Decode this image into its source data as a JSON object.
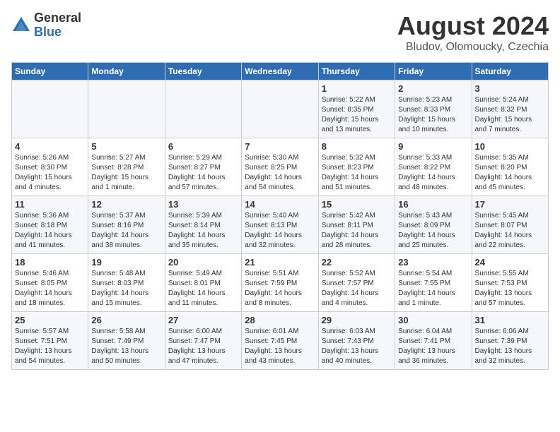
{
  "logo": {
    "general": "General",
    "blue": "Blue"
  },
  "title": {
    "month_year": "August 2024",
    "location": "Bludov, Olomoucky, Czechia"
  },
  "days_of_week": [
    "Sunday",
    "Monday",
    "Tuesday",
    "Wednesday",
    "Thursday",
    "Friday",
    "Saturday"
  ],
  "weeks": [
    [
      {
        "day": "",
        "info": ""
      },
      {
        "day": "",
        "info": ""
      },
      {
        "day": "",
        "info": ""
      },
      {
        "day": "",
        "info": ""
      },
      {
        "day": "1",
        "info": "Sunrise: 5:22 AM\nSunset: 8:35 PM\nDaylight: 15 hours\nand 13 minutes."
      },
      {
        "day": "2",
        "info": "Sunrise: 5:23 AM\nSunset: 8:33 PM\nDaylight: 15 hours\nand 10 minutes."
      },
      {
        "day": "3",
        "info": "Sunrise: 5:24 AM\nSunset: 8:32 PM\nDaylight: 15 hours\nand 7 minutes."
      }
    ],
    [
      {
        "day": "4",
        "info": "Sunrise: 5:26 AM\nSunset: 8:30 PM\nDaylight: 15 hours\nand 4 minutes."
      },
      {
        "day": "5",
        "info": "Sunrise: 5:27 AM\nSunset: 8:28 PM\nDaylight: 15 hours\nand 1 minute."
      },
      {
        "day": "6",
        "info": "Sunrise: 5:29 AM\nSunset: 8:27 PM\nDaylight: 14 hours\nand 57 minutes."
      },
      {
        "day": "7",
        "info": "Sunrise: 5:30 AM\nSunset: 8:25 PM\nDaylight: 14 hours\nand 54 minutes."
      },
      {
        "day": "8",
        "info": "Sunrise: 5:32 AM\nSunset: 8:23 PM\nDaylight: 14 hours\nand 51 minutes."
      },
      {
        "day": "9",
        "info": "Sunrise: 5:33 AM\nSunset: 8:22 PM\nDaylight: 14 hours\nand 48 minutes."
      },
      {
        "day": "10",
        "info": "Sunrise: 5:35 AM\nSunset: 8:20 PM\nDaylight: 14 hours\nand 45 minutes."
      }
    ],
    [
      {
        "day": "11",
        "info": "Sunrise: 5:36 AM\nSunset: 8:18 PM\nDaylight: 14 hours\nand 41 minutes."
      },
      {
        "day": "12",
        "info": "Sunrise: 5:37 AM\nSunset: 8:16 PM\nDaylight: 14 hours\nand 38 minutes."
      },
      {
        "day": "13",
        "info": "Sunrise: 5:39 AM\nSunset: 8:14 PM\nDaylight: 14 hours\nand 35 minutes."
      },
      {
        "day": "14",
        "info": "Sunrise: 5:40 AM\nSunset: 8:13 PM\nDaylight: 14 hours\nand 32 minutes."
      },
      {
        "day": "15",
        "info": "Sunrise: 5:42 AM\nSunset: 8:11 PM\nDaylight: 14 hours\nand 28 minutes."
      },
      {
        "day": "16",
        "info": "Sunrise: 5:43 AM\nSunset: 8:09 PM\nDaylight: 14 hours\nand 25 minutes."
      },
      {
        "day": "17",
        "info": "Sunrise: 5:45 AM\nSunset: 8:07 PM\nDaylight: 14 hours\nand 22 minutes."
      }
    ],
    [
      {
        "day": "18",
        "info": "Sunrise: 5:46 AM\nSunset: 8:05 PM\nDaylight: 14 hours\nand 18 minutes."
      },
      {
        "day": "19",
        "info": "Sunrise: 5:48 AM\nSunset: 8:03 PM\nDaylight: 14 hours\nand 15 minutes."
      },
      {
        "day": "20",
        "info": "Sunrise: 5:49 AM\nSunset: 8:01 PM\nDaylight: 14 hours\nand 11 minutes."
      },
      {
        "day": "21",
        "info": "Sunrise: 5:51 AM\nSunset: 7:59 PM\nDaylight: 14 hours\nand 8 minutes."
      },
      {
        "day": "22",
        "info": "Sunrise: 5:52 AM\nSunset: 7:57 PM\nDaylight: 14 hours\nand 4 minutes."
      },
      {
        "day": "23",
        "info": "Sunrise: 5:54 AM\nSunset: 7:55 PM\nDaylight: 14 hours\nand 1 minute."
      },
      {
        "day": "24",
        "info": "Sunrise: 5:55 AM\nSunset: 7:53 PM\nDaylight: 13 hours\nand 57 minutes."
      }
    ],
    [
      {
        "day": "25",
        "info": "Sunrise: 5:57 AM\nSunset: 7:51 PM\nDaylight: 13 hours\nand 54 minutes."
      },
      {
        "day": "26",
        "info": "Sunrise: 5:58 AM\nSunset: 7:49 PM\nDaylight: 13 hours\nand 50 minutes."
      },
      {
        "day": "27",
        "info": "Sunrise: 6:00 AM\nSunset: 7:47 PM\nDaylight: 13 hours\nand 47 minutes."
      },
      {
        "day": "28",
        "info": "Sunrise: 6:01 AM\nSunset: 7:45 PM\nDaylight: 13 hours\nand 43 minutes."
      },
      {
        "day": "29",
        "info": "Sunrise: 6:03 AM\nSunset: 7:43 PM\nDaylight: 13 hours\nand 40 minutes."
      },
      {
        "day": "30",
        "info": "Sunrise: 6:04 AM\nSunset: 7:41 PM\nDaylight: 13 hours\nand 36 minutes."
      },
      {
        "day": "31",
        "info": "Sunrise: 6:06 AM\nSunset: 7:39 PM\nDaylight: 13 hours\nand 32 minutes."
      }
    ]
  ]
}
